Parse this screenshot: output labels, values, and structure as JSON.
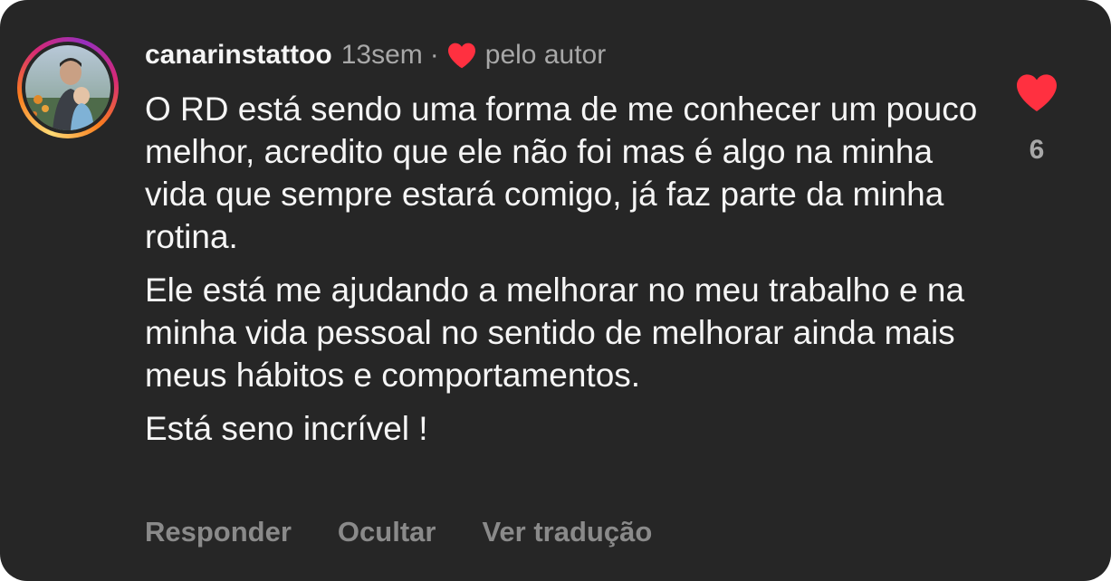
{
  "comment": {
    "username": "canarinstattoo",
    "time_ago": "13sem",
    "separator": "·",
    "liked_by_author_label": "pelo autor",
    "paragraphs": [
      "O RD está sendo uma forma de me conhecer um pouco melhor, acredito que ele não foi mas é algo na minha vida que sempre estará comigo, já faz parte da minha rotina.",
      "Ele está me ajudando a melhorar no meu trabalho e na minha vida pessoal no sentido de melhorar ainda mais meus hábitos e comportamentos.",
      "Está seno incrível !"
    ],
    "like_count": "6",
    "liked": true
  },
  "actions": {
    "reply_label": "Responder",
    "hide_label": "Ocultar",
    "translate_label": "Ver tradução"
  },
  "icons": {
    "author_heart": "heart-icon",
    "like_heart": "heart-icon"
  },
  "colors": {
    "background": "#262626",
    "heart": "#ff3040",
    "muted_text": "#a8a8a8"
  }
}
